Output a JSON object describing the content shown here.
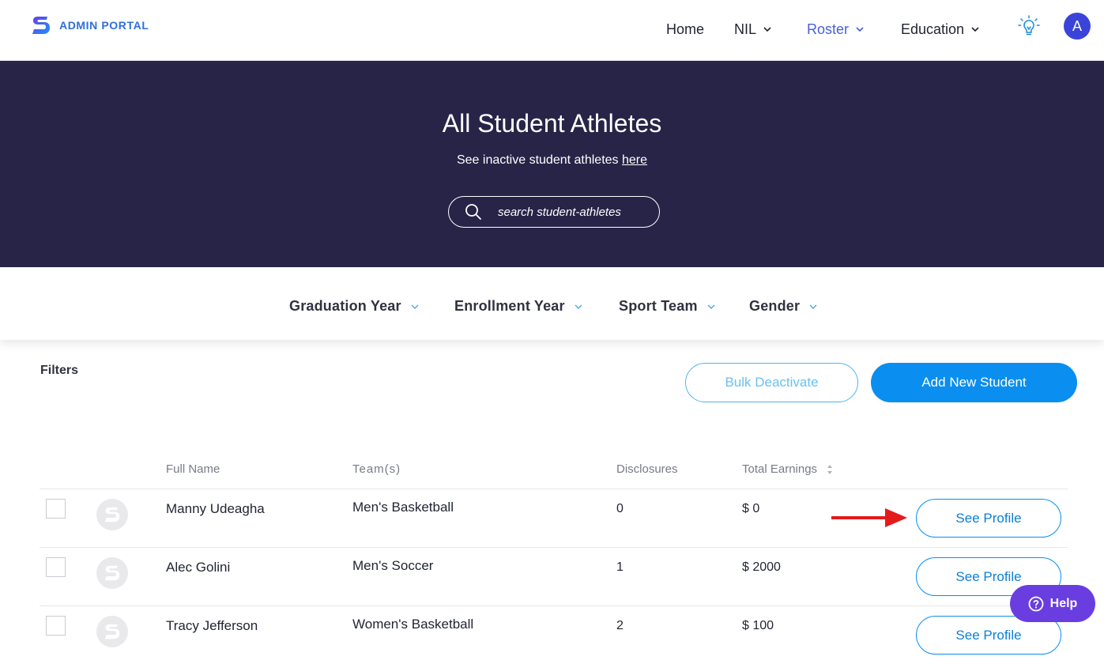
{
  "header": {
    "brand": "ADMIN PORTAL",
    "nav": {
      "home": "Home",
      "nil": "NIL",
      "roster": "Roster",
      "education": "Education"
    },
    "avatar_initial": "A",
    "accent_color": "#4b5fd6"
  },
  "hero": {
    "title": "All Student Athletes",
    "subtitle": "See inactive student athletes",
    "subtitle_link": "here",
    "search_placeholder": "search student-athletes"
  },
  "filter_dropdowns": {
    "graduation_year": "Graduation Year",
    "enrollment_year": "Enrollment Year",
    "sport_team": "Sport Team",
    "gender": "Gender"
  },
  "toolbar": {
    "filters_label": "Filters",
    "bulk_deactivate": "Bulk Deactivate",
    "add_new_student": "Add New Student"
  },
  "table": {
    "columns": {
      "full_name": "Full Name",
      "teams": "Team(s)",
      "disclosures": "Disclosures",
      "total_earnings": "Total Earnings"
    },
    "rows": [
      {
        "name": "Manny Udeagha",
        "team": "Men's Basketball",
        "disclosures": "0",
        "earnings": "$ 0",
        "action": "See Profile"
      },
      {
        "name": "Alec Golini",
        "team": "Men's Soccer",
        "disclosures": "1",
        "earnings": "$ 2000",
        "action": "See Profile"
      },
      {
        "name": "Tracy Jefferson",
        "team": "Women's Basketball",
        "disclosures": "2",
        "earnings": "$ 100",
        "action": "See Profile"
      }
    ]
  },
  "help": {
    "label": "Help"
  },
  "colors": {
    "hero_bg": "#272448",
    "primary_blue": "#0a8ef0",
    "help_purple": "#6a3de0",
    "annotation_arrow": "#e31b1b"
  }
}
